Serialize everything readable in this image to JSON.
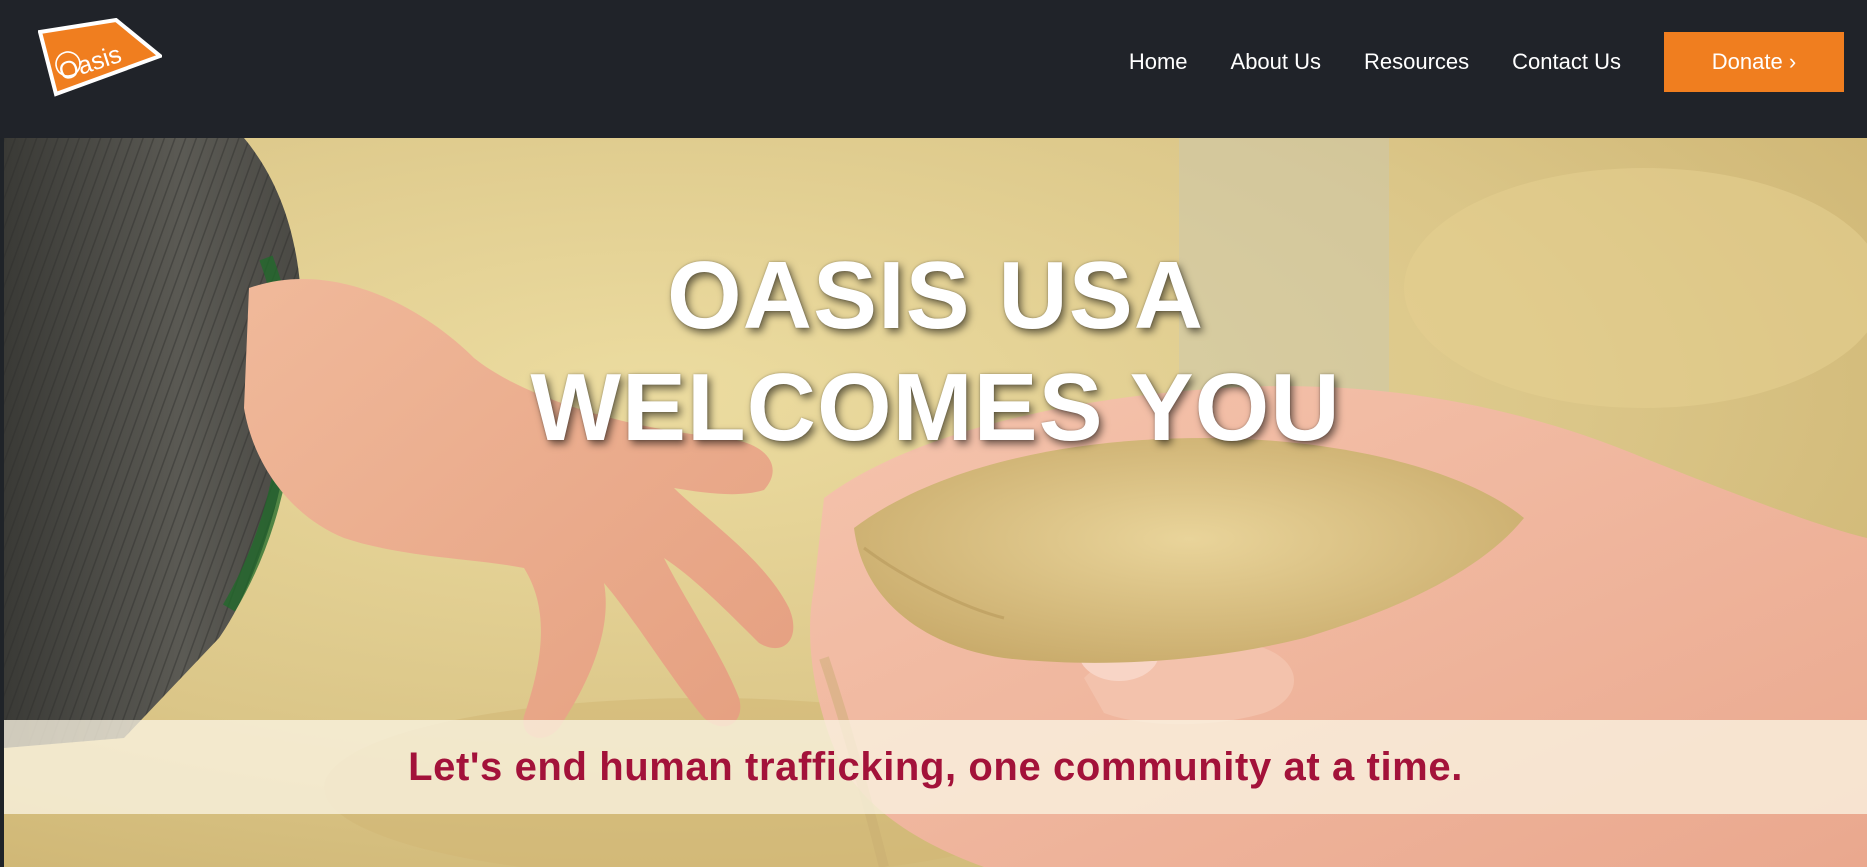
{
  "header": {
    "logo_text": "Oasis",
    "nav": [
      {
        "label": "Home"
      },
      {
        "label": "About Us"
      },
      {
        "label": "Resources"
      },
      {
        "label": "Contact Us"
      }
    ],
    "donate_label": "Donate ›"
  },
  "hero": {
    "title_line1": "OASIS USA",
    "title_line2": "WELCOMES YOU",
    "tagline": "Let's end human trafficking, one community at a time."
  },
  "colors": {
    "header_bg": "#202329",
    "accent_orange": "#f07e1f",
    "tagline_red": "#a3123a",
    "tagline_band": "#faf4e2"
  },
  "icons": {
    "logo": "oasis-logo-icon"
  }
}
